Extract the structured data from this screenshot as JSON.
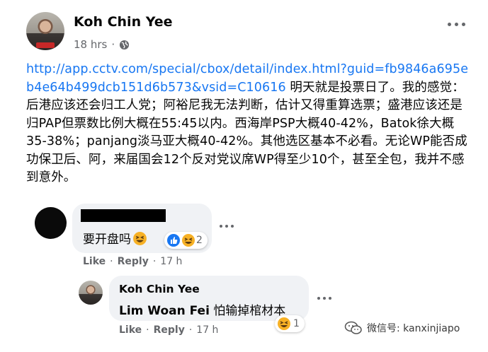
{
  "post": {
    "author": "Koh Chin Yee",
    "time": "18 hrs",
    "dot": "·",
    "link_text": "http://app.cctv.com/special/cbox/detail/index.html?guid=fb9846a695eb4e64b499dcb151d6b573&vsid=C10616",
    "body_text": " 明天就是投票日了。我的感觉：后港应该还会归工人党；阿裕尼我无法判断，估计又得重算选票；盛港应该还是归PAP但票数比例大概在55:45以内。西海岸PSP大概40-42%，Batok徐大概35-38%；panjang淡马亚大概40-42%。其他选区基本不必看。无论WP能否成功保卫后、阿，来届国会12个反对党议席WP得至少10个，甚至全包，我并不感到意外。"
  },
  "comments": [
    {
      "text": "要开盘吗",
      "reaction_count": "2",
      "like_label": "Like",
      "reply_label": "Reply",
      "sep": "·",
      "time": "17 h"
    },
    {
      "author": "Koh Chin Yee",
      "tag": "Lim Woan Fei",
      "text": " 怕输掉棺材本",
      "reaction_count": "1",
      "like_label": "Like",
      "reply_label": "Reply",
      "sep": "·",
      "time": "17 h"
    }
  ],
  "watermark": {
    "text": "微信号: kanxinjiapo"
  },
  "icons": {
    "globe": "globe-icon",
    "more": "more-options-icon",
    "like_reaction": "like-reaction-icon",
    "haha_reaction": "haha-reaction-icon",
    "wechat": "wechat-icon"
  },
  "colors": {
    "link": "#1877f2",
    "bubble": "#f0f2f5",
    "meta": "#65676b",
    "like_blue": "#1877f2",
    "haha_yellow": "#f7b125"
  }
}
